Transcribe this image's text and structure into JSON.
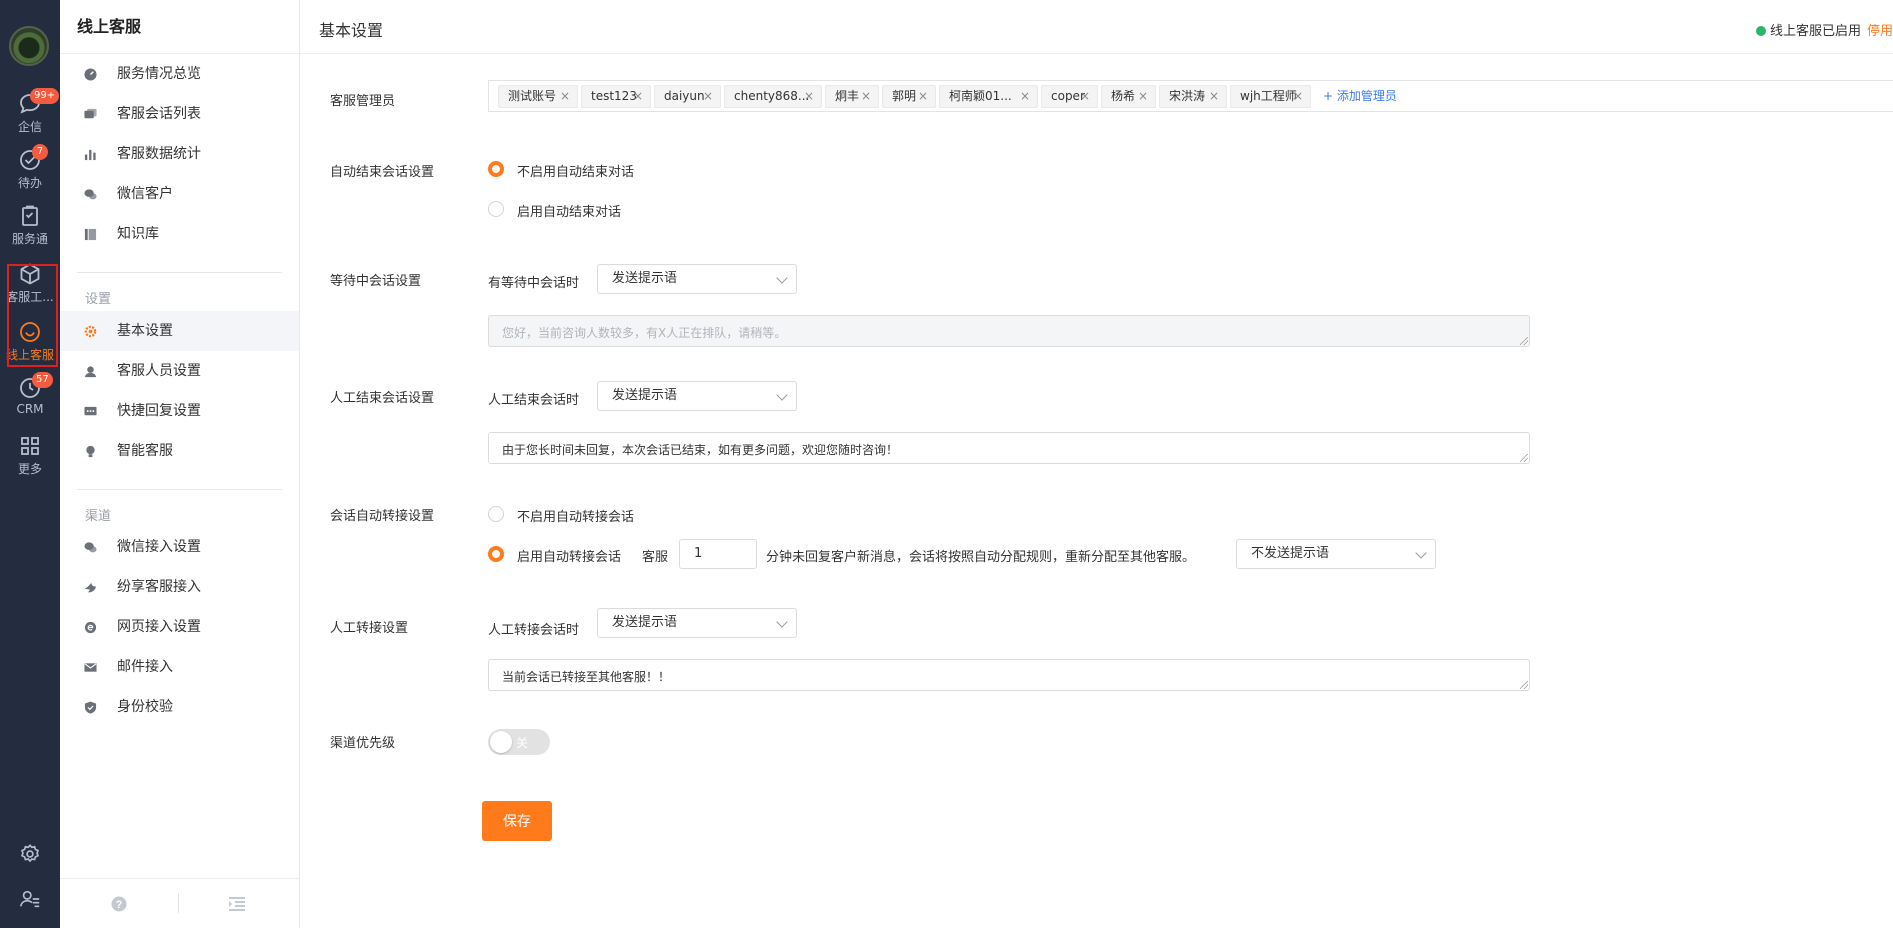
{
  "rail": {
    "items": [
      {
        "label": "企信",
        "badge": "99+"
      },
      {
        "label": "待办",
        "badge": "7"
      },
      {
        "label": "服务通"
      },
      {
        "label": "客服工..."
      },
      {
        "label": "线上客服"
      },
      {
        "label": "CRM",
        "badge": "57"
      },
      {
        "label": "更多"
      }
    ]
  },
  "sidebar": {
    "title": "线上客服",
    "group1": [
      {
        "label": "服务情况总览"
      },
      {
        "label": "客服会话列表"
      },
      {
        "label": "客服数据统计"
      },
      {
        "label": "微信客户"
      },
      {
        "label": "知识库"
      }
    ],
    "settings_label": "设置",
    "group2": [
      {
        "label": "基本设置"
      },
      {
        "label": "客服人员设置"
      },
      {
        "label": "快捷回复设置"
      },
      {
        "label": "智能客服"
      }
    ],
    "channels_label": "渠道",
    "group3": [
      {
        "label": "微信接入设置"
      },
      {
        "label": "纷享客服接入"
      },
      {
        "label": "网页接入设置"
      },
      {
        "label": "邮件接入"
      },
      {
        "label": "身份校验"
      }
    ]
  },
  "header": {
    "title": "基本设置",
    "status_text": "线上客服已启用",
    "stop_label": "停用"
  },
  "form": {
    "admins": {
      "label": "客服管理员",
      "tags": [
        "测试账号",
        "test123",
        "daiyun",
        "chenty868...",
        "炯丰",
        "郭明",
        "柯南颖01...",
        "coper",
        "杨希",
        "宋洪涛",
        "wjh工程师"
      ],
      "add_label": "+ 添加管理员"
    },
    "auto_end": {
      "label": "自动结束会话设置",
      "opt_off": "不启用自动结束对话",
      "opt_on": "启用自动结束对话"
    },
    "waiting": {
      "label": "等待中会话设置",
      "sub_label": "有等待中会话时",
      "select_value": "发送提示语",
      "placeholder": "您好，当前咨询人数较多，有X人正在排队，请稍等。"
    },
    "manual_end": {
      "label": "人工结束会话设置",
      "sub_label": "人工结束会话时",
      "select_value": "发送提示语",
      "text": "由于您长时间未回复，本次会话已结束，如有更多问题，欢迎您随时咨询！"
    },
    "auto_transfer": {
      "label": "会话自动转接设置",
      "opt_off": "不启用自动转接会话",
      "opt_on": "启用自动转接会话",
      "prefix": "客服",
      "minutes": "1",
      "suffix": "分钟未回复客户新消息，会话将按照自动分配规则，重新分配至其他客服。",
      "select_value": "不发送提示语"
    },
    "manual_transfer": {
      "label": "人工转接设置",
      "sub_label": "人工转接会话时",
      "select_value": "发送提示语",
      "text": "当前会话已转接至其他客服！！"
    },
    "priority": {
      "label": "渠道优先级",
      "toggle_text": "关"
    },
    "save_label": "保存"
  },
  "colors": {
    "accent": "#ff7a1a",
    "rail_bg": "#232d3f",
    "link": "#3a7bf0",
    "status_ok": "#2cb36e"
  }
}
